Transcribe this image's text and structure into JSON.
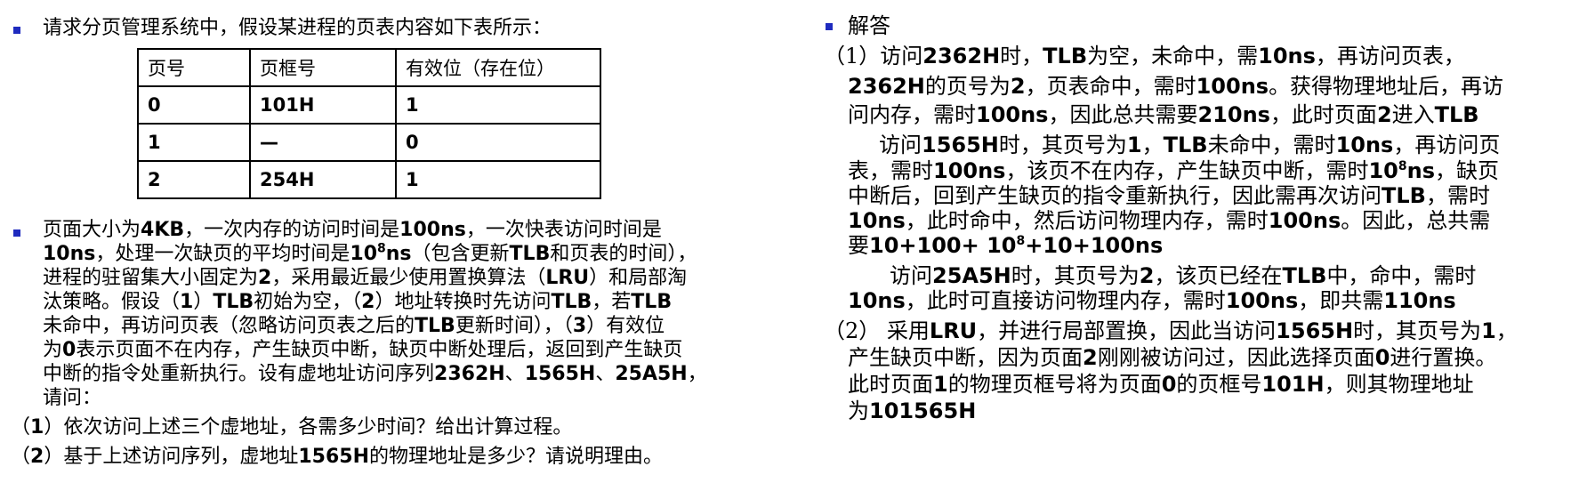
{
  "left": {
    "intro": "请求分页管理系统中，假设某进程的页表内容如下表所示：",
    "table": {
      "headers": [
        "页号",
        "页框号",
        "有效位（存在位）"
      ],
      "rows": [
        [
          "0",
          "101H",
          "1"
        ],
        [
          "1",
          "—",
          "0"
        ],
        [
          "2",
          "254H",
          "1"
        ]
      ]
    },
    "para": {
      "l1a": "页面大小为",
      "l1b": "4KB",
      "l1c": "，一次内存的访问时间是",
      "l1d": "100ns",
      "l1e": "，一次快表访问时间是",
      "l2a": "10ns",
      "l2b": "，处理一次缺页的平均时间是",
      "l2c": "10",
      "l2sup": "8",
      "l2d": "ns",
      "l2e": "（包含更新",
      "l2f": "TLB",
      "l2g": "和页表的时间），",
      "l3a": "进程的驻留集大小固定为",
      "l3b": "2",
      "l3c": "，采用最近最少使用置换算法（",
      "l3d": "LRU",
      "l3e": "）和局部淘",
      "l4a": "汰策略。假设（",
      "l4b": "1",
      "l4c": "）",
      "l4d": "TLB",
      "l4e": "初始为空，（",
      "l4f": "2",
      "l4g": "）地址转换时先访问",
      "l4h": "TLB",
      "l4i": "，若",
      "l4j": "TLB",
      "l5a": "未命中，再访问页表（忽略访问页表之后的",
      "l5b": "TLB",
      "l5c": "更新时间），（",
      "l5d": "3",
      "l5e": "）有效位",
      "l6a": "为",
      "l6b": "0",
      "l6c": "表示页面不在内存，产生缺页中断，缺页中断处理后，返回到产生缺页",
      "l7a": "中断的指令处重新执行。设有虚地址访问序列",
      "l7b": "2362H",
      "l7c": "、",
      "l7d": "1565H",
      "l7e": "、",
      "l7f": "25A5H",
      "l7g": "，",
      "l8": "请问："
    },
    "q1a": "（",
    "q1b": "1",
    "q1c": "）依次访问上述三个虚地址，各需多少时间？给出计算过程。",
    "q2a": "（",
    "q2b": "2",
    "q2c": "）基于上述访问序列，虚地址",
    "q2d": "1565H",
    "q2e": "的物理地址是多少？请说明理由。"
  },
  "right": {
    "heading": "解答",
    "a1": {
      "l1a": "（1）访问",
      "l1b": "2362H",
      "l1c": "时，",
      "l1d": "TLB",
      "l1e": "为空，未命中，需",
      "l1f": "10ns",
      "l1g": "，再访问页表，",
      "l2a": "2362H",
      "l2b": "的页号为",
      "l2c": "2",
      "l2d": "，页表命中，需时",
      "l2e": "100ns",
      "l2f": "。获得物理地址后，再访",
      "l3a": "问内存，需时",
      "l3b": "100ns",
      "l3c": "，因此总共需要",
      "l3d": "210ns",
      "l3e": "，此时页面",
      "l3f": "2",
      "l3g": "进入",
      "l3h": "TLB",
      "l4a": "访问",
      "l4b": "1565H",
      "l4c": "时，其页号为",
      "l4d": "1",
      "l4e": "，",
      "l4f": "TLB",
      "l4g": "未命中，需时",
      "l4h": "10ns",
      "l4i": "，再访问页",
      "l5a": "表，需时",
      "l5b": "100ns",
      "l5c": "，该页不在内存，产生缺页中断，需时",
      "l5d": "10",
      "l5sup": "8",
      "l5e": "ns",
      "l5f": "，缺页",
      "l6a": "中断后，回到产生缺页的指令重新执行，因此需再次访问",
      "l6b": "TLB",
      "l6c": "，需时",
      "l7a": "10ns",
      "l7b": "，此时命中，然后访问物理内存，需时",
      "l7c": "100ns",
      "l7d": "。因此，总共需",
      "l8a": "要",
      "l8b": "10+100+ 10",
      "l8sup": "8",
      "l8c": "+10+100ns",
      "l9a": "访问",
      "l9b": "25A5H",
      "l9c": "时，其页号为",
      "l9d": "2",
      "l9e": "，该页已经在",
      "l9f": "TLB",
      "l9g": "中，命中，需时",
      "l10a": "10ns",
      "l10b": "，此时可直接访问物理内存，需时",
      "l10c": "100ns",
      "l10d": "，即共需",
      "l10e": "110ns"
    },
    "a2": {
      "l1a": "（2） 采用",
      "l1b": "LRU",
      "l1c": "，并进行局部置换，因此当访问",
      "l1d": "1565H",
      "l1e": "时，其页号为",
      "l1f": "1",
      "l1g": "，",
      "l2a": "产生缺页中断，因为页面",
      "l2b": "2",
      "l2c": "刚刚被访问过，因此选择页面",
      "l2d": "0",
      "l2e": "进行置换。",
      "l3a": "此时页面",
      "l3b": "1",
      "l3c": "的物理页框号将为页面",
      "l3d": "0",
      "l3e": "的页框号",
      "l3f": "101H",
      "l3g": "，则其物理地址",
      "l4a": "为",
      "l4b": "101565H"
    }
  }
}
